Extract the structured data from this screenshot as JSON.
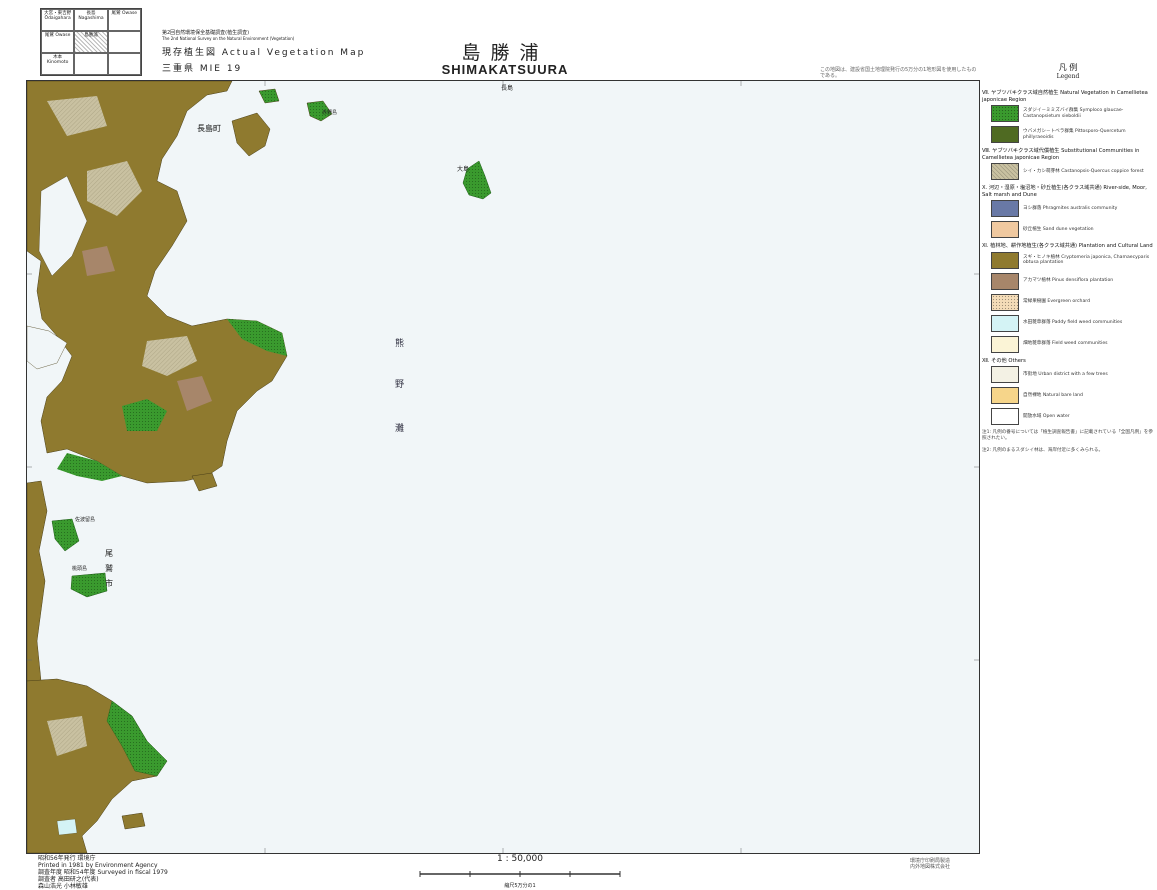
{
  "index_grid": {
    "cells": [
      {
        "name": "大宮・東吉野 Ōdaigahara",
        "current": false
      },
      {
        "name": "長島 Nagashima",
        "current": false
      },
      {
        "name": "尾鷲 Owase",
        "current": false
      },
      {
        "name": "尾鷲 Owase",
        "current": false
      },
      {
        "name": "島勝浦",
        "current": true
      },
      {
        "name": "",
        "current": false
      },
      {
        "name": "木本 Kinomoto",
        "current": false
      },
      {
        "name": "",
        "current": false
      },
      {
        "name": "",
        "current": false
      }
    ]
  },
  "header": {
    "survey_line": "第2回自然環境保全基礎調査(植生調査)",
    "survey_line_en": "The 2nd National Survey on the Natural Environment (Vegetation)",
    "map_type": "現存植生図 Actual Vegetation Map",
    "prefecture_code": "三重県 MIE 19",
    "title_jp": "島勝浦",
    "title_en": "SHIMAKATSUURA",
    "note": "この地図は、建設省国土地理院発行の5万分の1地形図を使用したものである。"
  },
  "map": {
    "place_labels": [
      {
        "text": "長島",
        "kind": "top"
      },
      {
        "text": "長島町",
        "kind": "town"
      },
      {
        "text": "赤野島",
        "kind": "island"
      },
      {
        "text": "大島",
        "kind": "island"
      },
      {
        "text": "熊",
        "kind": "sea"
      },
      {
        "text": "野",
        "kind": "sea"
      },
      {
        "text": "灘",
        "kind": "sea"
      },
      {
        "text": "尾",
        "kind": "coast"
      },
      {
        "text": "鷲",
        "kind": "coast"
      },
      {
        "text": "市",
        "kind": "coast"
      },
      {
        "text": "佐波留島",
        "kind": "island"
      },
      {
        "text": "桃頭島",
        "kind": "island"
      }
    ]
  },
  "legend": {
    "title": "凡 例",
    "subtitle": "Legend",
    "sections": [
      {
        "title": "Ⅶ. ヤブツバキクラス域自然植生 Natural Vegetation in Camellietea japonicae Region",
        "items": [
          {
            "code": "",
            "label": "スダジイ－ミミズバイ群集 Symploco glaucae-Castanopsietum sieboldii",
            "color": "#3a9a2e",
            "pattern": "dots"
          },
          {
            "code": "",
            "label": "ウバメガシ－トベラ群集 Pittosporo-Quercetum phillyraeoidis",
            "color": "#4f6a22",
            "pattern": "none"
          }
        ]
      },
      {
        "title": "Ⅷ. ヤブツバキクラス域代償植生 Substitutional Communities in Camellietea japonicae Region",
        "items": [
          {
            "code": "",
            "label": "シイ・カシ萌芽林 Castanopsis-Quercus coppice forest",
            "color": "#c9c1a1",
            "pattern": "hatch"
          }
        ]
      },
      {
        "title": "Ⅹ. 河辺・湿原・塩沼地・砂丘植生(各クラス域共通) River-side, Moor, Salt marsh and Dune",
        "items": [
          {
            "code": "",
            "label": "ヨシ群落 Phragmites australis community",
            "color": "#6979a6",
            "pattern": "none"
          },
          {
            "code": "",
            "label": "砂丘植生 Sand dune vegetation",
            "color": "#f0c9a0",
            "pattern": "none"
          }
        ]
      },
      {
        "title": "Ⅺ. 植林地、耕作地植生(各クラス域共通) Plantation and Cultural Land",
        "items": [
          {
            "code": "",
            "label": "スギ・ヒノキ植林 Cryptomeria japonica, Chamaecyparis obtusa plantation",
            "color": "#8f7a2f",
            "pattern": "none"
          },
          {
            "code": "",
            "label": "アカマツ植林 Pinus densiflora plantation",
            "color": "#a7866a",
            "pattern": "none"
          },
          {
            "code": "",
            "label": "常緑果樹園 Evergreen orchard",
            "color": "#f4dcb8",
            "pattern": "dots"
          },
          {
            "code": "",
            "label": "水田雑草群落 Paddy field weed communities",
            "color": "#d4f3f5",
            "pattern": "none"
          },
          {
            "code": "",
            "label": "畑地雑草群落 Field weed communities",
            "color": "#fbf4d6",
            "pattern": "none"
          }
        ]
      },
      {
        "title": "Ⅻ. その他 Others",
        "items": [
          {
            "code": "",
            "label": "市街地 Urban district with a few trees",
            "color": "#f3f1e4",
            "pattern": "none"
          },
          {
            "code": "",
            "label": "自然裸地 Natural bare land",
            "color": "#f6d58a",
            "pattern": "none"
          },
          {
            "code": "",
            "label": "開放水域 Open water",
            "color": "#ffffff",
            "pattern": "none"
          }
        ]
      }
    ],
    "notes": [
      "注1: 凡例の番号については「植生調査報告書」に記載されている「全国凡例」を参照されたい。",
      "注2: 凡例のまるスダシイ林は、海岸付近に多くみられる。"
    ]
  },
  "footer": {
    "publisher_line1": "昭和56年発行  環境庁",
    "publisher_line2": "Printed in 1981 by Environment Agency",
    "survey_line": "調査年度 昭和54年度  Surveyed in fiscal 1979",
    "surveyors": "調査者 高田研之(代表)",
    "surveyors2": "森山浩光 小林敏雄",
    "scale": "1 : 50,000",
    "scale_caption": "縮尺5万分の1",
    "right_note1": "環境庁印刷局製造",
    "right_note2": "内外地図株式会社"
  },
  "colors": {
    "sea": "#f1f6f8",
    "plantation": "#8f7a2f",
    "natural_forest": "#3a9a2e",
    "coppice": "#c9c1a1",
    "pine": "#a7866a",
    "paddy": "#d4f3f5"
  }
}
